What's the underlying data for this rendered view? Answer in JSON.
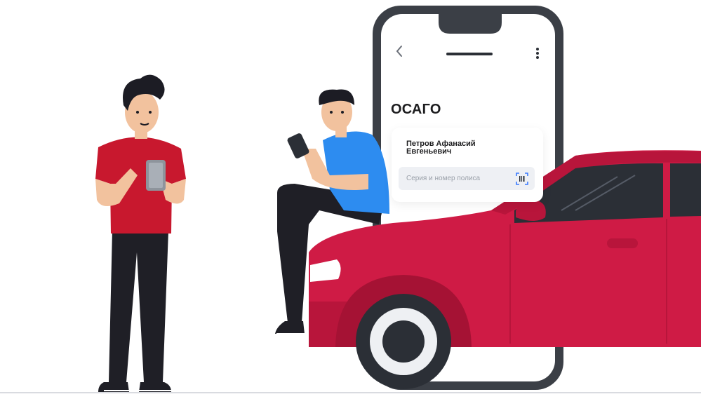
{
  "phone": {
    "title": "ОСАГО",
    "owner_name": "Петров Афанасий Евгеньевич",
    "policy_input": {
      "placeholder": "Серия и номер полиса"
    },
    "icons": {
      "back": "chevron-left-icon",
      "menu": "more-vertical-icon",
      "scan": "barcode-scan-icon"
    }
  },
  "colors": {
    "car_red": "#cf1b45",
    "shirt_red": "#c8182e",
    "shirt_blue": "#2d8cf0",
    "phone_frame": "#3b3f46",
    "skin": "#f2c29e",
    "hair": "#1c1c24"
  }
}
